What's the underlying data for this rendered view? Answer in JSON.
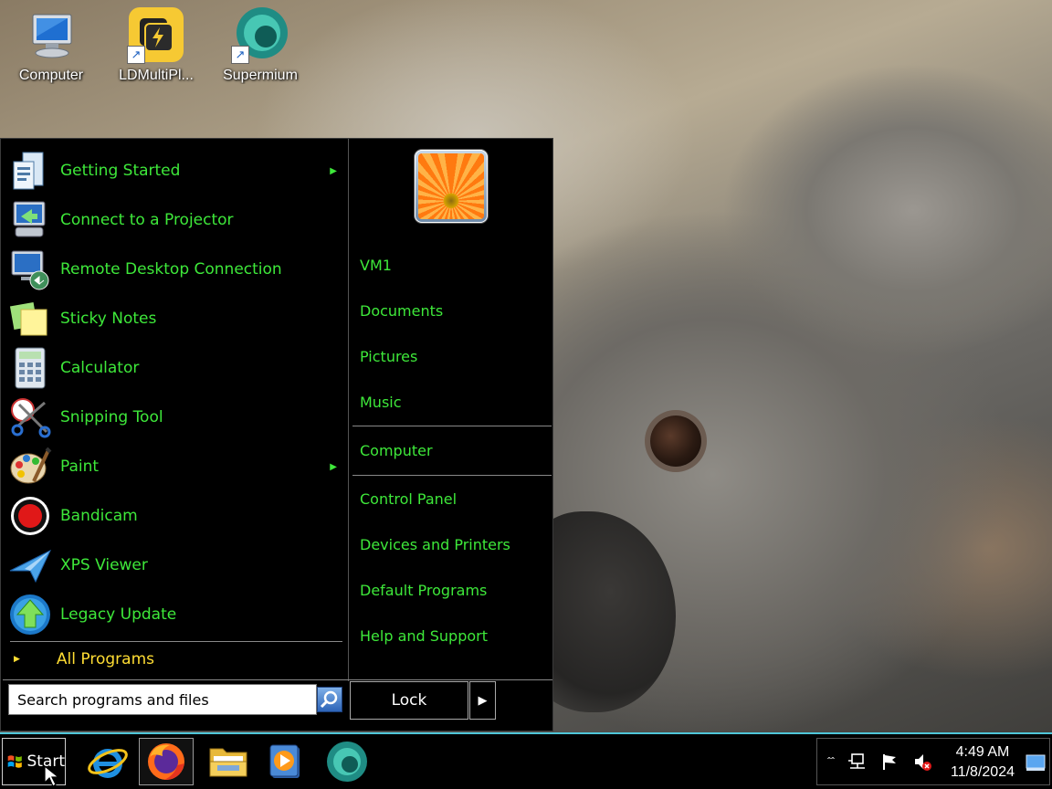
{
  "desktop": {
    "icons": [
      {
        "label": "Computer",
        "icon": "computer-icon"
      },
      {
        "label": "LDMultiPl...",
        "icon": "ldmultiplayer-icon",
        "shortcut": true
      },
      {
        "label": "Supermium",
        "icon": "supermium-icon",
        "shortcut": true
      }
    ]
  },
  "start_menu": {
    "programs": [
      {
        "label": "Getting Started",
        "icon": "getting-started-icon",
        "submenu": true
      },
      {
        "label": "Connect to a Projector",
        "icon": "projector-icon",
        "submenu": false
      },
      {
        "label": "Remote Desktop Connection",
        "icon": "remote-desktop-icon",
        "submenu": false
      },
      {
        "label": "Sticky Notes",
        "icon": "sticky-notes-icon",
        "submenu": false
      },
      {
        "label": "Calculator",
        "icon": "calculator-icon",
        "submenu": false
      },
      {
        "label": "Snipping Tool",
        "icon": "snipping-tool-icon",
        "submenu": false
      },
      {
        "label": "Paint",
        "icon": "paint-icon",
        "submenu": true
      },
      {
        "label": "Bandicam",
        "icon": "bandicam-icon",
        "submenu": false
      },
      {
        "label": "XPS Viewer",
        "icon": "xps-viewer-icon",
        "submenu": false
      },
      {
        "label": "Legacy Update",
        "icon": "legacy-update-icon",
        "submenu": false
      }
    ],
    "all_programs": "All Programs",
    "search_placeholder": "Search programs and files",
    "right_items": {
      "user": "VM1",
      "documents": "Documents",
      "pictures": "Pictures",
      "music": "Music",
      "computer": "Computer",
      "control_panel": "Control Panel",
      "devices_printers": "Devices and Printers",
      "default_programs": "Default Programs",
      "help_support": "Help and Support"
    },
    "lock_label": "Lock"
  },
  "taskbar": {
    "start_label": "Start",
    "apps": [
      "internet-explorer-icon",
      "firefox-icon",
      "file-explorer-icon",
      "media-player-icon",
      "supermium-icon"
    ],
    "time": "4:49 AM",
    "date": "11/8/2024"
  },
  "colors": {
    "menu_text": "#3ee83a",
    "all_programs": "#ffdd33",
    "taskbar_border": "#4fc6d8"
  }
}
